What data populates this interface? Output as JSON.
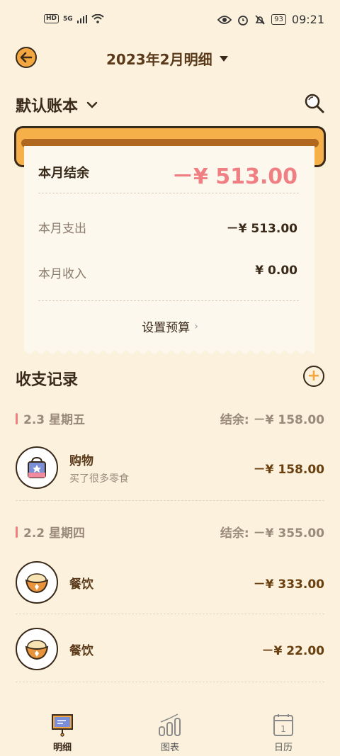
{
  "status_bar": {
    "left_badges": [
      "HD",
      "5G"
    ],
    "battery": "93",
    "time": "09:21"
  },
  "header": {
    "title": "2023年2月明细",
    "account_book": "默认账本"
  },
  "summary": {
    "balance_label": "本月结余",
    "balance_value": "－¥ 513.00",
    "expense_label": "本月支出",
    "expense_value": "－¥ 513.00",
    "income_label": "本月收入",
    "income_value": "¥ 0.00",
    "budget_label": "设置预算"
  },
  "records": {
    "title": "收支记录",
    "days": [
      {
        "date": "2.3 星期五",
        "balance_label": "结余:",
        "balance_value": "－¥ 158.00",
        "items": [
          {
            "category": "购物",
            "note": "买了很多零食",
            "amount": "－¥ 158.00",
            "icon": "shopping-bag-icon"
          }
        ]
      },
      {
        "date": "2.2 星期四",
        "balance_label": "结余:",
        "balance_value": "－¥ 355.00",
        "items": [
          {
            "category": "餐饮",
            "note": "",
            "amount": "－¥ 333.00",
            "icon": "food-bowl-icon"
          },
          {
            "category": "餐饮",
            "note": "",
            "amount": "－¥ 22.00",
            "icon": "food-bowl-icon"
          }
        ]
      }
    ]
  },
  "tabs": [
    {
      "label": "明细",
      "icon": "board-icon",
      "active": true
    },
    {
      "label": "图表",
      "icon": "chart-icon",
      "active": false
    },
    {
      "label": "日历",
      "icon": "calendar-icon",
      "active": false
    }
  ],
  "colors": {
    "background": "#fbf1dc",
    "accent": "#f4a640",
    "expense_red": "#ef7f83",
    "text_dark": "#3a2a1a"
  }
}
